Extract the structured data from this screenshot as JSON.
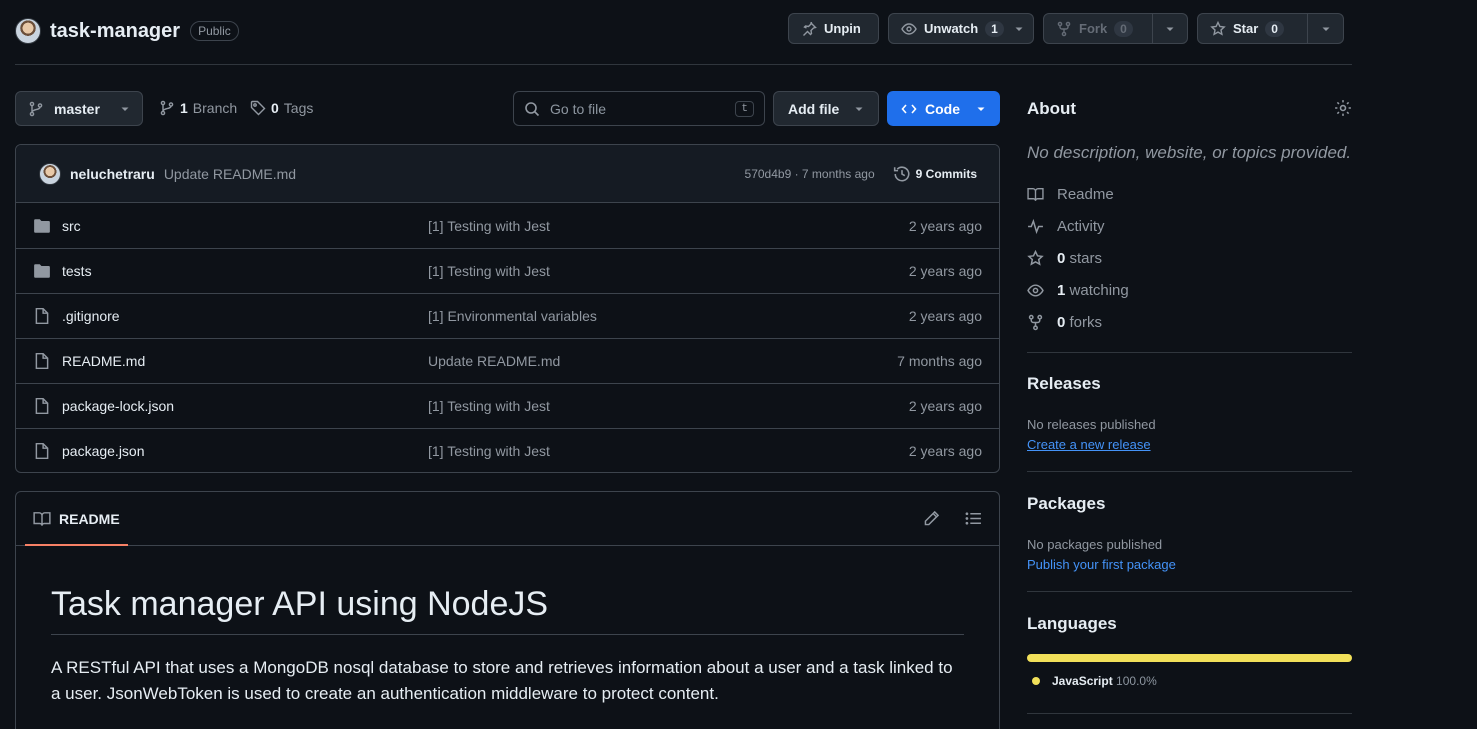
{
  "repo": {
    "name": "task-manager",
    "visibility": "Public"
  },
  "actions": {
    "unpin": "Unpin",
    "unwatch": "Unwatch",
    "watch_count": "1",
    "fork": "Fork",
    "fork_count": "0",
    "star": "Star",
    "star_count": "0"
  },
  "toolbar": {
    "branch": "master",
    "branch_count": "1",
    "branch_label": "Branch",
    "tag_count": "0",
    "tag_label": "Tags",
    "search_placeholder": "Go to file",
    "search_shortcut": "t",
    "add_file": "Add file",
    "code": "Code"
  },
  "latest_commit": {
    "user": "neluchetraru",
    "message": "Update README.md",
    "meta": "570d4b9 · 7 months ago",
    "commits_label": "9 Commits"
  },
  "files": [
    {
      "name": "src",
      "type": "folder",
      "message": "[1] Testing with Jest",
      "date": "2 years ago"
    },
    {
      "name": "tests",
      "type": "folder",
      "message": "[1] Testing with Jest",
      "date": "2 years ago"
    },
    {
      "name": ".gitignore",
      "type": "file",
      "message": "[1] Environmental variables",
      "date": "2 years ago"
    },
    {
      "name": "README.md",
      "type": "file",
      "message": "Update README.md",
      "date": "7 months ago"
    },
    {
      "name": "package-lock.json",
      "type": "file",
      "message": "[1] Testing with Jest",
      "date": "2 years ago"
    },
    {
      "name": "package.json",
      "type": "file",
      "message": "[1] Testing with Jest",
      "date": "2 years ago"
    }
  ],
  "readme": {
    "tab": "README",
    "title": "Task manager API using NodeJS",
    "text": "A RESTful API that uses a MongoDB nosql database to store and retrieves information about a user and a task linked to a user. JsonWebToken is used to create an authentication middleware to protect content."
  },
  "about": {
    "title": "About",
    "description": "No description, website, or topics provided.",
    "readme": "Readme",
    "activity": "Activity",
    "stars_count": "0",
    "stars_label": "stars",
    "watching_count": "1",
    "watching_label": "watching",
    "forks_count": "0",
    "forks_label": "forks"
  },
  "releases": {
    "title": "Releases",
    "empty": "No releases published",
    "link": "Create a new release"
  },
  "packages": {
    "title": "Packages",
    "empty": "No packages published",
    "link": "Publish your first package"
  },
  "languages": {
    "title": "Languages",
    "items": [
      {
        "name": "JavaScript",
        "percent": "100.0%",
        "color": "#f1e05a"
      }
    ]
  }
}
